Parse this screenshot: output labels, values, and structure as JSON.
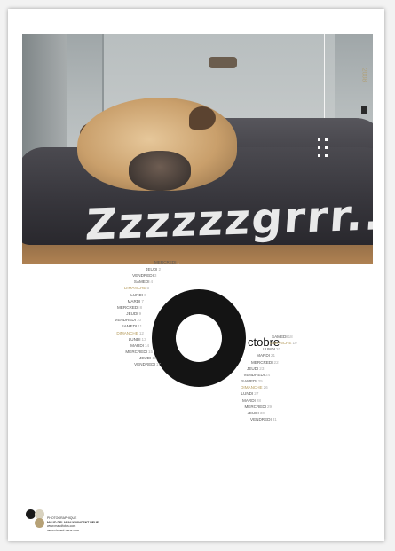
{
  "photo": {
    "caption": "Zzzzzzgrrr..",
    "edge_label": "2008"
  },
  "calendar": {
    "big_letter": "O",
    "month_rest": "ctobre",
    "days": [
      {
        "label": "MERCREDI",
        "num": "1"
      },
      {
        "label": "JEUDI",
        "num": "2"
      },
      {
        "label": "VENDREDI",
        "num": "3"
      },
      {
        "label": "SAMEDI",
        "num": "4"
      },
      {
        "label": "DIMANCHE",
        "num": "5"
      },
      {
        "label": "LUNDI",
        "num": "6"
      },
      {
        "label": "MARDI",
        "num": "7"
      },
      {
        "label": "MERCREDI",
        "num": "8"
      },
      {
        "label": "JEUDI",
        "num": "9"
      },
      {
        "label": "VENDREDI",
        "num": "10"
      },
      {
        "label": "SAMEDI",
        "num": "11"
      },
      {
        "label": "DIMANCHE",
        "num": "12"
      },
      {
        "label": "LUNDI",
        "num": "13"
      },
      {
        "label": "MARDI",
        "num": "14"
      },
      {
        "label": "MERCREDI",
        "num": "15"
      },
      {
        "label": "JEUDI",
        "num": "16"
      },
      {
        "label": "VENDREDI",
        "num": "17"
      },
      {
        "label": "SAMEDI",
        "num": "18"
      },
      {
        "label": "DIMANCHE",
        "num": "19"
      },
      {
        "label": "LUNDI",
        "num": "20"
      },
      {
        "label": "MARDI",
        "num": "21"
      },
      {
        "label": "MERCREDI",
        "num": "22"
      },
      {
        "label": "JEUDI",
        "num": "23"
      },
      {
        "label": "VENDREDI",
        "num": "24"
      },
      {
        "label": "SAMEDI",
        "num": "25"
      },
      {
        "label": "DIMANCHE",
        "num": "26"
      },
      {
        "label": "LUNDI",
        "num": "27"
      },
      {
        "label": "MARDI",
        "num": "28"
      },
      {
        "label": "MERCREDI",
        "num": "29"
      },
      {
        "label": "JEUDI",
        "num": "30"
      },
      {
        "label": "VENDREDI",
        "num": "31"
      }
    ],
    "sunday_color": "#b49a5a"
  },
  "footer": {
    "line1": "PHOTOGRAPHIQUE",
    "line2": "MAUD DELANAUX/VINCENT NEUE",
    "line3": "www.maudfotos.com",
    "line4": "www.vincent-neue.com"
  }
}
